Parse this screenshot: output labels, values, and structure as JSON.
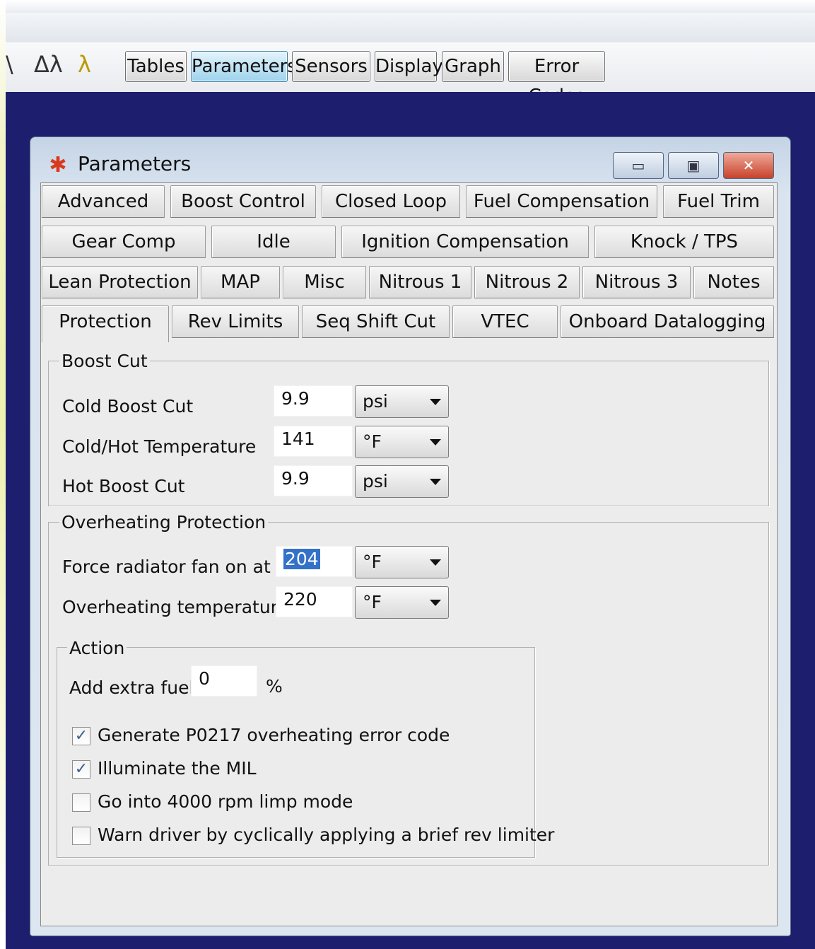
{
  "toolbar": {
    "icons": [
      "wave-icon",
      "delta-lambda-icon",
      "lambda-run-icon"
    ],
    "icon_glyphs": [
      "\\",
      "Δλ",
      "λ"
    ],
    "buttons": [
      "Tables",
      "Parameters",
      "Sensors",
      "Display",
      "Graph",
      "Error Codes"
    ],
    "active": "Parameters"
  },
  "window": {
    "title": "Parameters",
    "minimize": "▭",
    "maximize": "▣",
    "close": "✕"
  },
  "tabs": {
    "row1": [
      "Advanced",
      "Boost Control",
      "Closed Loop",
      "Fuel Compensation",
      "Fuel Trim"
    ],
    "row2": [
      "Gear Comp",
      "Idle",
      "Ignition Compensation",
      "Knock / TPS"
    ],
    "row3": [
      "Lean Protection",
      "MAP",
      "Misc",
      "Nitrous 1",
      "Nitrous 2",
      "Nitrous 3",
      "Notes"
    ],
    "row4": [
      "Protection",
      "Rev Limits",
      "Seq Shift Cut",
      "VTEC",
      "Onboard Datalogging"
    ],
    "selected": "Protection"
  },
  "boost_cut": {
    "title": "Boost Cut",
    "rows": [
      {
        "label": "Cold Boost Cut",
        "value": "9.9",
        "unit": "psi"
      },
      {
        "label": "Cold/Hot Temperature",
        "value": "141",
        "unit": "°F"
      },
      {
        "label": "Hot Boost Cut",
        "value": "9.9",
        "unit": "psi"
      }
    ]
  },
  "overheating": {
    "title": "Overheating Protection",
    "rows": [
      {
        "label": "Force radiator fan on at",
        "value": "204",
        "unit": "°F"
      },
      {
        "label": "Overheating temperature",
        "value": "220",
        "unit": "°F"
      }
    ],
    "action": {
      "title": "Action",
      "extra_fuel_label": "Add extra fuel",
      "extra_fuel_value": "0",
      "extra_fuel_unit": "%",
      "checks": [
        {
          "label": "Generate P0217 overheating error code",
          "checked": true
        },
        {
          "label": "Illuminate the MIL",
          "checked": true
        },
        {
          "label": "Go into 4000 rpm limp mode",
          "checked": false
        },
        {
          "label": "Warn driver by cyclically applying a brief rev limiter",
          "checked": false
        }
      ]
    }
  },
  "colors": {
    "desktop": "#1e1e6e",
    "selection": "#3471c8",
    "active_button": "#9ed3ec"
  }
}
